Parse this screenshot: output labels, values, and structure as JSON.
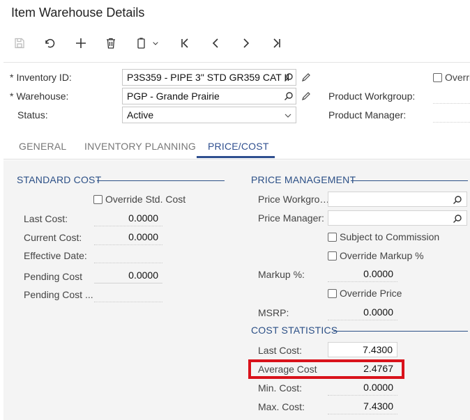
{
  "page": {
    "title": "Item Warehouse Details"
  },
  "toolbar": {
    "buttons": [
      "save-icon",
      "undo-icon",
      "add-icon",
      "delete-icon",
      "copy-paste-icon",
      "first-icon",
      "previous-icon",
      "next-icon",
      "last-icon"
    ]
  },
  "header": {
    "inventory_id_label": "Inventory ID:",
    "inventory_id_value": "P3S359 - PIPE 3\" STD GR359 CAT II",
    "warehouse_label": "Warehouse:",
    "warehouse_value": "PGP - Grande Prairie",
    "status_label": "Status:",
    "status_value": "Active",
    "override_label": "Overri",
    "product_workgroup_label": "Product Workgroup:",
    "product_manager_label": "Product Manager:",
    "required_mark": "*"
  },
  "tabs": [
    {
      "label": "GENERAL"
    },
    {
      "label": "INVENTORY PLANNING"
    },
    {
      "label": "PRICE/COST",
      "active": true
    }
  ],
  "standard_cost": {
    "title": "STANDARD COST",
    "override_label": "Override Std. Cost",
    "last_cost_label": "Last Cost:",
    "last_cost_value": "0.0000",
    "current_cost_label": "Current Cost:",
    "current_cost_value": "0.0000",
    "effective_date_label": "Effective Date:",
    "pending_cost_label": "Pending Cost",
    "pending_cost_value": "0.0000",
    "pending_cost_date_label": "Pending Cost ..."
  },
  "price_management": {
    "title": "PRICE MANAGEMENT",
    "price_workgroup_label": "Price Workgro…",
    "price_manager_label": "Price Manager:",
    "subject_commission_label": "Subject to Commission",
    "override_markup_label": "Override Markup %",
    "markup_label": "Markup %:",
    "markup_value": "0.0000",
    "override_price_label": "Override Price",
    "msrp_label": "MSRP:",
    "msrp_value": "0.0000"
  },
  "cost_statistics": {
    "title": "COST STATISTICS",
    "last_cost_label": "Last Cost:",
    "last_cost_value": "7.4300",
    "average_cost_label": "Average Cost",
    "average_cost_value": "2.4767",
    "min_cost_label": "Min. Cost:",
    "min_cost_value": "0.0000",
    "max_cost_label": "Max. Cost:",
    "max_cost_value": "7.4300"
  },
  "colors": {
    "accent": "#2b4f86",
    "highlight": "#d9121b"
  }
}
